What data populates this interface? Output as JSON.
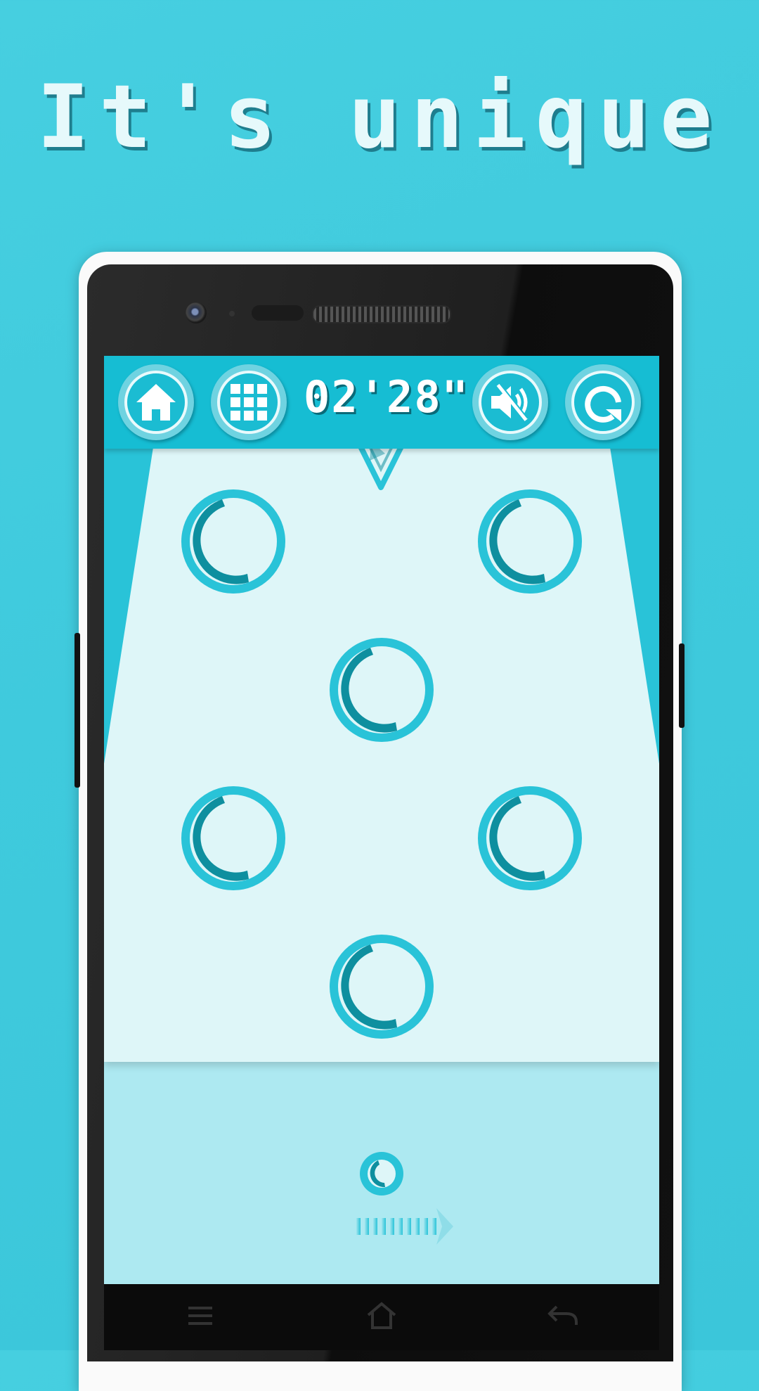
{
  "headline": "It's unique",
  "toolbar": {
    "timer": "02'28\"",
    "home_icon": "home-icon",
    "levels_icon": "grid-icon",
    "sound_icon": "sound-off-icon",
    "restart_icon": "restart-icon"
  },
  "board": {
    "rings": 6,
    "shape_icon": "triangle-icon"
  },
  "nav": {
    "menu_icon": "menu-icon",
    "home_icon": "home-outline-icon",
    "back_icon": "back-icon"
  },
  "colors": {
    "background": "#3fcadd",
    "bar": "#16bdd3",
    "board": "#def6f8",
    "ring_light": "#29c3d8",
    "ring_dark": "#0e8f9f",
    "tray": "#ade9f1"
  }
}
